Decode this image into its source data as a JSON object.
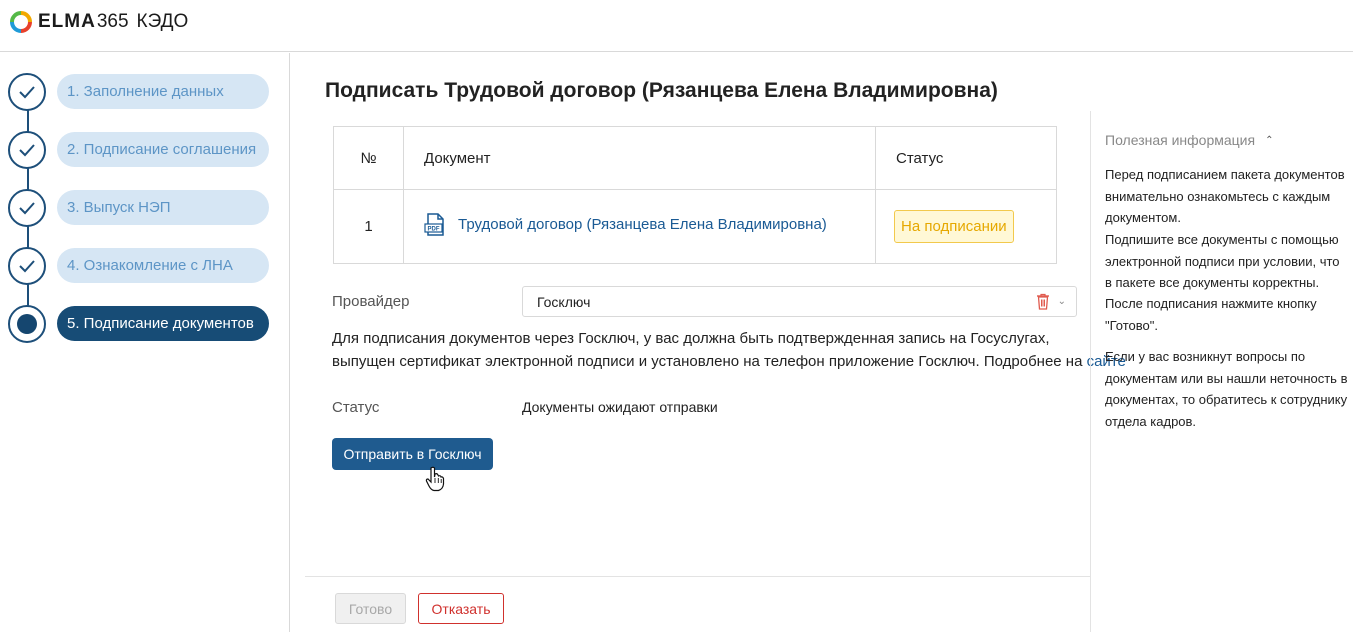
{
  "header": {
    "logo_brand": "ELMA",
    "logo_number": "365",
    "product": "КЭДО"
  },
  "steps": [
    {
      "label": "1. Заполнение данных",
      "state": "done"
    },
    {
      "label": "2. Подписание соглашения",
      "state": "done"
    },
    {
      "label": "3. Выпуск НЭП",
      "state": "done"
    },
    {
      "label": "4. Ознакомление с ЛНА",
      "state": "done"
    },
    {
      "label": "5. Подписание документов",
      "state": "current"
    }
  ],
  "main": {
    "title": "Подписать Трудовой договор (Рязанцева Елена Владимировна)",
    "table": {
      "headers": [
        "№",
        "Документ",
        "Статус"
      ],
      "rows": [
        {
          "num": "1",
          "document": "Трудовой договор (Рязанцева Елена Владимировна)",
          "status": "На подписании"
        }
      ]
    },
    "provider_label": "Провайдер",
    "provider_value": "Госключ",
    "info_line1": "Для подписания документов через Госключ, у вас должна быть подтвержденная запись на Госуслугах,",
    "info_line2": "выпущен сертификат электронной подписи и установлено на телефон приложение Госключ. Подробнее на",
    "info_link": "сайте",
    "status_label": "Статус",
    "status_value": "Документы ожидают отправки",
    "send_button": "Отправить в Госключ",
    "ready_button": "Готово",
    "cancel_button": "Отказать"
  },
  "side": {
    "title": "Полезная информация",
    "paragraph1": "Перед подписанием пакета документов внимательно ознакомьтесь с каждым документом.",
    "paragraph2": "Подпишите все документы с помощью электронной подписи при условии, что в пакете все документы корректны.",
    "paragraph3": "После подписания нажмите кнопку \"Готово\".",
    "paragraph4": "Если у вас возникнут вопросы по документам или вы нашли неточность в документах, то обратитесь к сотруднику отдела кадров."
  },
  "colors": {
    "primary": "#1f5b8f",
    "step_done_bg": "#d6e6f4",
    "step_done_text": "#5d95c6",
    "step_current_bg": "#174c76",
    "badge_border": "#f2c94c",
    "badge_text": "#e6a800",
    "danger": "#d0312d"
  },
  "icons": [
    "elma-logo-icon",
    "check-icon",
    "pdf-icon",
    "trash-icon",
    "chevron-down-icon",
    "chevron-up-icon",
    "hand-cursor-icon"
  ]
}
